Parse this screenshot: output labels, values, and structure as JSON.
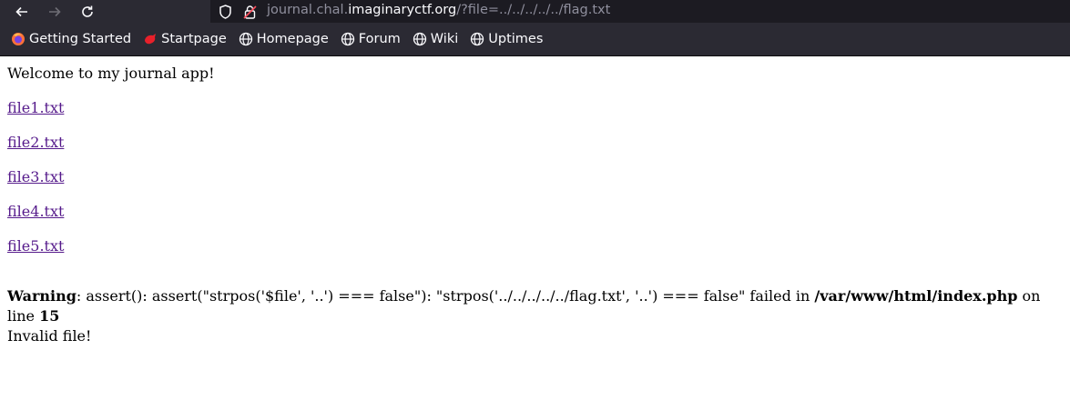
{
  "browser": {
    "url_prefix": "journal.chal.",
    "url_domain": "imaginaryctf.org",
    "url_path": "/?file=../../../../../flag.txt",
    "bookmarks": [
      {
        "label": "Getting Started",
        "icon": "firefox-icon"
      },
      {
        "label": "Startpage",
        "icon": "startpage-icon"
      },
      {
        "label": "Homepage",
        "icon": "globe-icon"
      },
      {
        "label": "Forum",
        "icon": "globe-icon"
      },
      {
        "label": "Wiki",
        "icon": "globe-icon"
      },
      {
        "label": "Uptimes",
        "icon": "globe-icon"
      }
    ]
  },
  "page": {
    "welcome": "Welcome to my journal app!",
    "links": [
      "file1.txt",
      "file2.txt",
      "file3.txt",
      "file4.txt",
      "file5.txt"
    ],
    "warning_label": "Warning",
    "warning_message": ": assert(): assert(\"strpos('$file', '..') === false\"): \"strpos('../../../../../flag.txt', '..') === false\" failed in ",
    "warning_path": "/var/www/html/index.php",
    "warning_on_line": " on line ",
    "warning_line": "15",
    "result": "Invalid file!"
  },
  "colors": {
    "toolbar_bg": "#2b2a33",
    "urlbar_bg": "#1c1b22",
    "visited_link": "#551a8b"
  }
}
